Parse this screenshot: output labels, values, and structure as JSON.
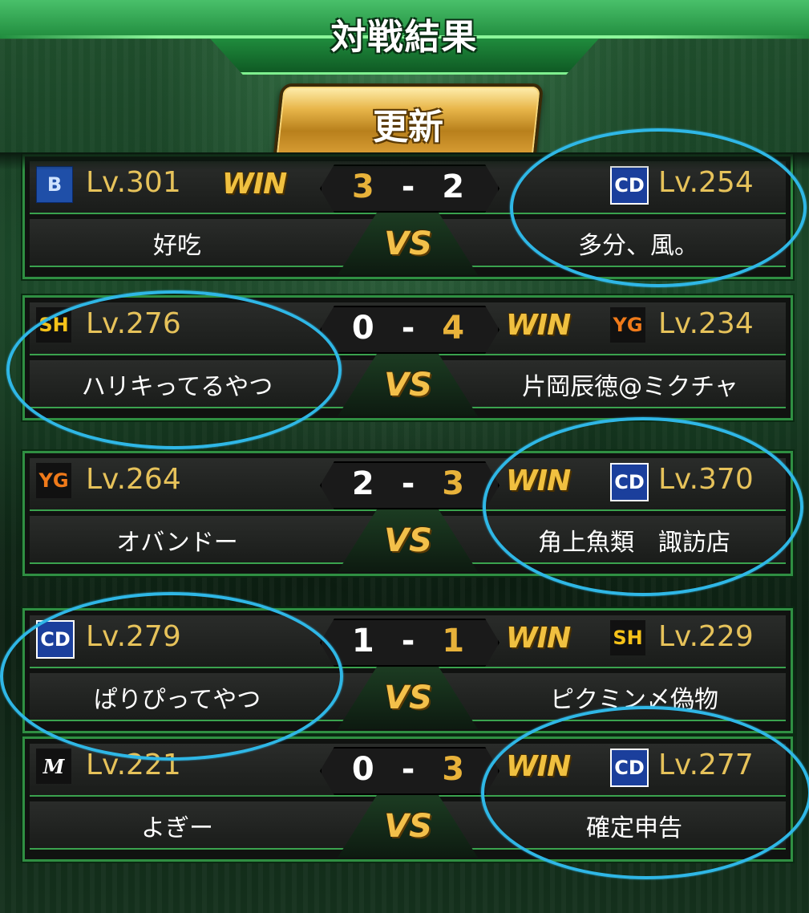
{
  "header": {
    "title": "対戦結果",
    "refresh_label": "更新"
  },
  "matches": [
    {
      "left": {
        "team_logo": "B",
        "level": "Lv.301",
        "name": "好吃",
        "win": true,
        "win_label": "WIN"
      },
      "right": {
        "team_logo": "CD",
        "level": "Lv.254",
        "name": "多分、風。",
        "win": false
      },
      "score_left": "3",
      "score_dash": "-",
      "score_right": "2",
      "vs": "VS"
    },
    {
      "left": {
        "team_logo": "SH",
        "level": "Lv.276",
        "name": "ハリキってるやつ",
        "win": false
      },
      "right": {
        "team_logo": "YG",
        "level": "Lv.234",
        "name": "片岡辰徳@ミクチャ",
        "win": true,
        "win_label": "WIN"
      },
      "score_left": "0",
      "score_dash": "-",
      "score_right": "4",
      "vs": "VS"
    },
    {
      "left": {
        "team_logo": "YG",
        "level": "Lv.264",
        "name": "オバンドー",
        "win": false
      },
      "right": {
        "team_logo": "CD",
        "level": "Lv.370",
        "name": "角上魚類　諏訪店",
        "win": true,
        "win_label": "WIN"
      },
      "score_left": "2",
      "score_dash": "-",
      "score_right": "3",
      "vs": "VS"
    },
    {
      "left": {
        "team_logo": "CD",
        "level": "Lv.279",
        "name": "ぱりぴってやつ",
        "win": false
      },
      "right": {
        "team_logo": "SH",
        "level": "Lv.229",
        "name": "ピクミン〆偽物",
        "win": true,
        "win_label": "WIN"
      },
      "score_left": "1",
      "score_dash": "-",
      "score_right": "1",
      "vs": "VS"
    },
    {
      "left": {
        "team_logo": "M",
        "level": "Lv.221",
        "name": "よぎー",
        "win": false
      },
      "right": {
        "team_logo": "CD",
        "level": "Lv.277",
        "name": "確定申告",
        "win": true,
        "win_label": "WIN"
      },
      "score_left": "0",
      "score_dash": "-",
      "score_right": "3",
      "vs": "VS"
    }
  ],
  "colors": {
    "accent_green": "#2f8f42",
    "gold": "#e8b23a",
    "highlight_circle": "#2fb7e6"
  }
}
